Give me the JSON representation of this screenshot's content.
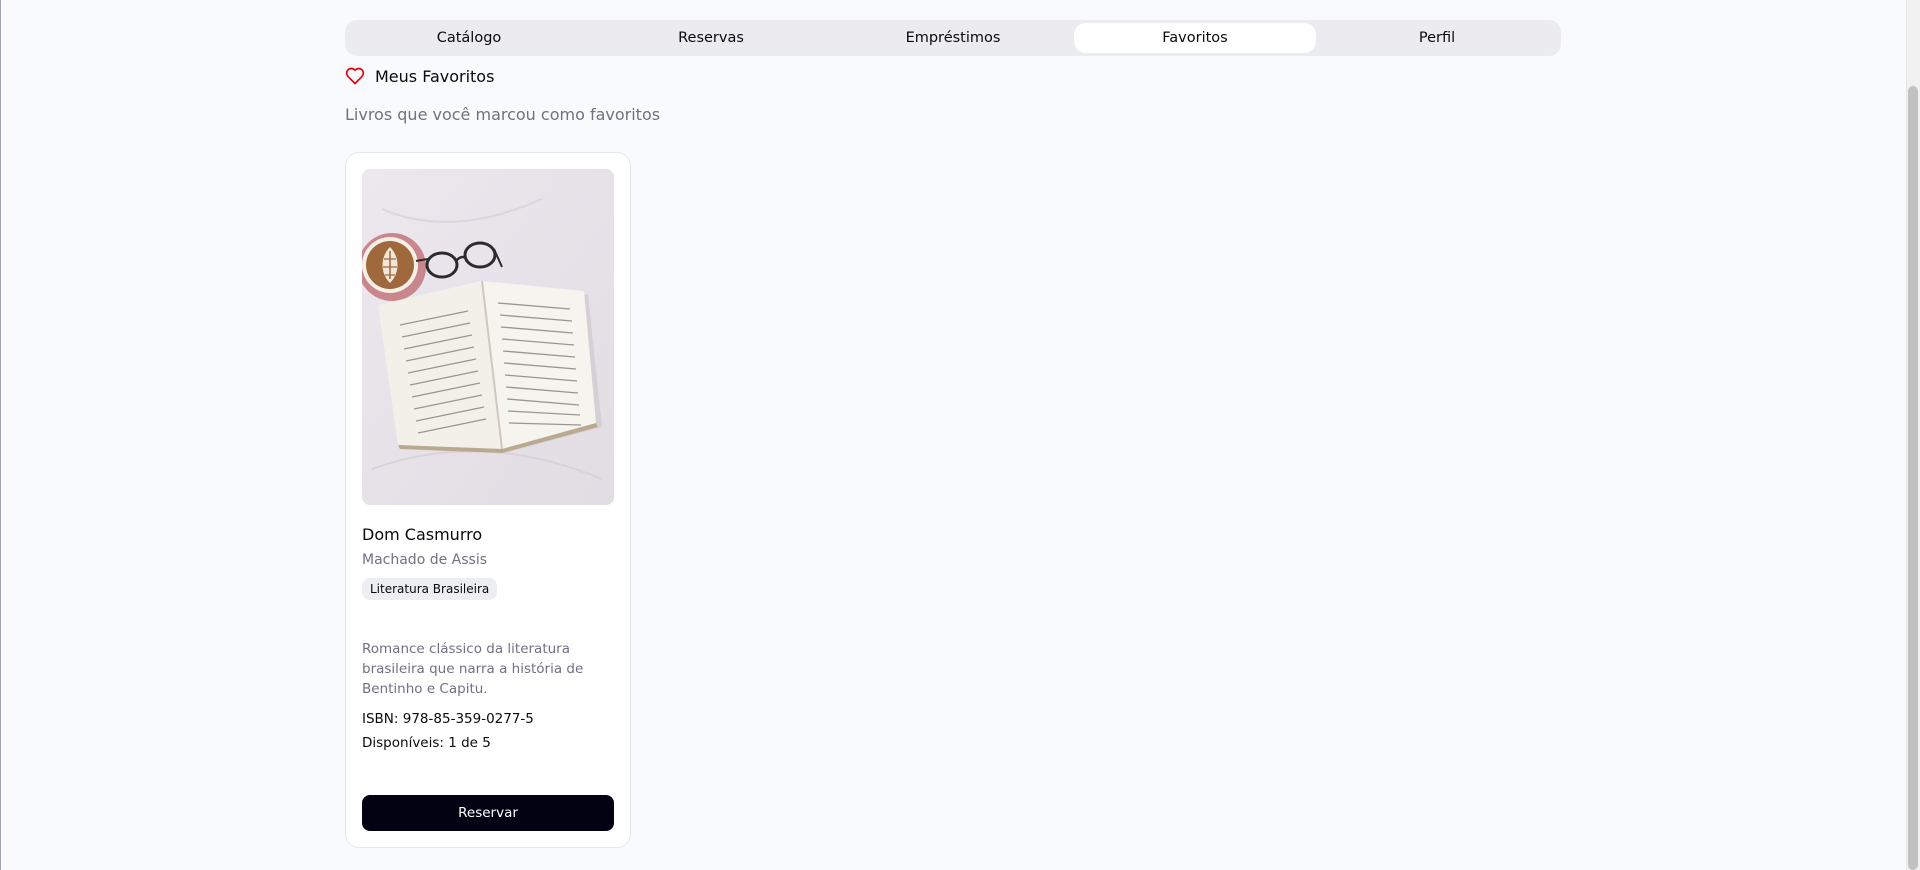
{
  "tabs": [
    {
      "label": "Catálogo",
      "active": false
    },
    {
      "label": "Reservas",
      "active": false
    },
    {
      "label": "Empréstimos",
      "active": false
    },
    {
      "label": "Favoritos",
      "active": true
    },
    {
      "label": "Perfil",
      "active": false
    }
  ],
  "section": {
    "title": "Meus Favoritos",
    "subtitle": "Livros que você marcou como favoritos",
    "icon": "heart-icon"
  },
  "books": [
    {
      "title": "Dom Casmurro",
      "author": "Machado de Assis",
      "category": "Literatura Brasileira",
      "description": "Romance clássico da literatura brasileira que narra a história de Bentinho e Capitu.",
      "isbn": "ISBN: 978-85-359-0277-5",
      "availability": "Disponíveis: 1 de 5",
      "action_label": "Reservar"
    }
  ],
  "colors": {
    "heart": "#e7000b",
    "button_bg": "#030213",
    "muted_text": "#717182",
    "tab_bar_bg": "#ececf0"
  }
}
